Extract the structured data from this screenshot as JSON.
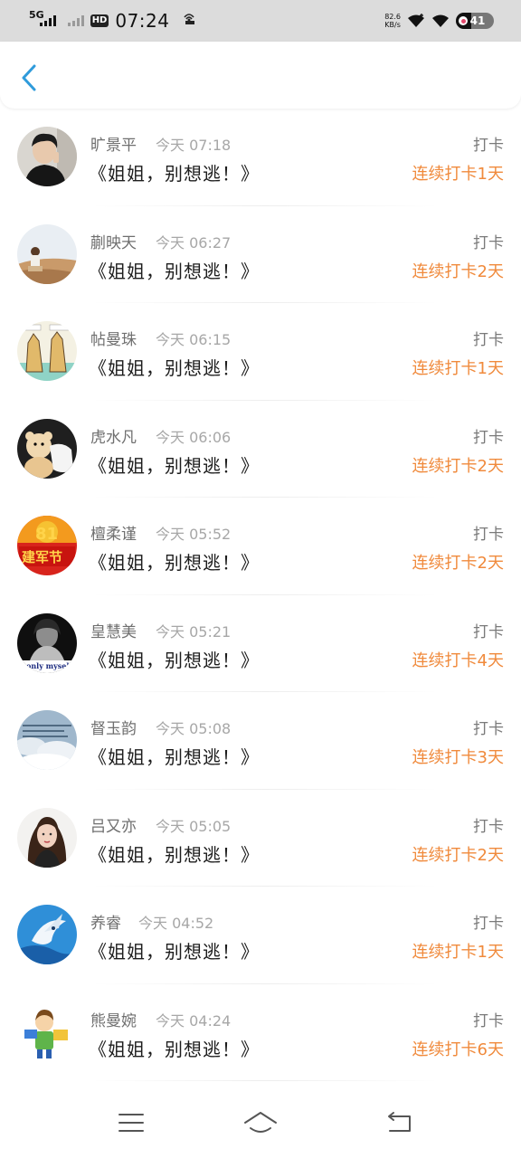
{
  "status_bar": {
    "network": "5G",
    "hd": "HD",
    "time": "07:24",
    "speed_value": "82.6",
    "speed_unit": "KB/s",
    "battery": "41",
    "battery_level": 0.41
  },
  "header": {
    "back_icon": "chevron-left-icon",
    "accent_color": "#2f9bdb"
  },
  "list": {
    "items": [
      {
        "name": "旷景平",
        "time": "今天 07:18",
        "title": "《姐姐，别想逃！》",
        "label": "打卡",
        "streak": "连续打卡1天"
      },
      {
        "name": "蒯映天",
        "time": "今天 06:27",
        "title": "《姐姐，别想逃！》",
        "label": "打卡",
        "streak": "连续打卡2天"
      },
      {
        "name": "帖曼珠",
        "time": "今天 06:15",
        "title": "《姐姐，别想逃！》",
        "label": "打卡",
        "streak": "连续打卡1天"
      },
      {
        "name": "虎水凡",
        "time": "今天 06:06",
        "title": "《姐姐，别想逃！》",
        "label": "打卡",
        "streak": "连续打卡2天"
      },
      {
        "name": "檀柔谨",
        "time": "今天 05:52",
        "title": "《姐姐，别想逃！》",
        "label": "打卡",
        "streak": "连续打卡2天"
      },
      {
        "name": "皇慧美",
        "time": "今天 05:21",
        "title": "《姐姐，别想逃！》",
        "label": "打卡",
        "streak": "连续打卡4天"
      },
      {
        "name": "督玉韵",
        "time": "今天 05:08",
        "title": "《姐姐，别想逃！》",
        "label": "打卡",
        "streak": "连续打卡3天"
      },
      {
        "name": "吕又亦",
        "time": "今天 05:05",
        "title": "《姐姐，别想逃！》",
        "label": "打卡",
        "streak": "连续打卡2天"
      },
      {
        "name": "养睿",
        "time": "今天 04:52",
        "title": "《姐姐，别想逃！》",
        "label": "打卡",
        "streak": "连续打卡1天"
      },
      {
        "name": "熊曼婉",
        "time": "今天 04:24",
        "title": "《姐姐，别想逃！》",
        "label": "打卡",
        "streak": "连续打卡6天"
      }
    ],
    "avatar_texts": {
      "avatar_5": "建军节",
      "avatar_6": "only myself"
    }
  },
  "nav_bar": {
    "menu_icon": "menu-icon",
    "home_icon": "home-icon",
    "back_icon": "back-icon"
  },
  "colors": {
    "streak": "#f08a3c",
    "name": "#6f6f6f",
    "time": "#a7a7a7",
    "title": "#1d1d1d"
  }
}
